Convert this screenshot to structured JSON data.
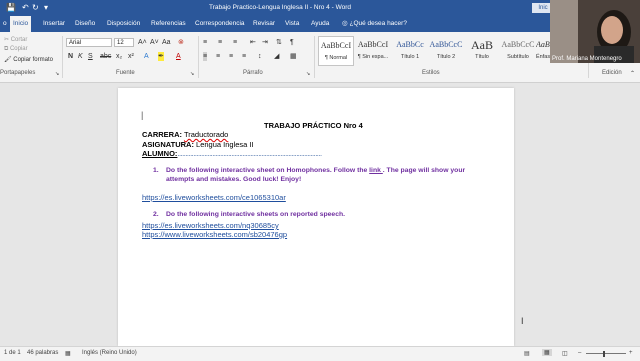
{
  "window": {
    "title": "Trabajo Practico-Lengua Inglesa II - Nro 4 - Word",
    "signin": "Inic"
  },
  "tabs": [
    "Inicio",
    "Insertar",
    "Diseño",
    "Disposición",
    "Referencias",
    "Correspondencia",
    "Revisar",
    "Vista",
    "Ayuda"
  ],
  "tab_file": "o",
  "tell_me": "¿Qué desea hacer?",
  "ribbon": {
    "clipboard": {
      "cut": "Cortar",
      "copy": "Copiar",
      "format_painter": "Copiar formato",
      "label": "Portapapeles"
    },
    "font": {
      "name": "Arial",
      "size": "12",
      "label": "Fuente"
    },
    "paragraph": {
      "label": "Párrafo"
    },
    "styles": {
      "label": "Estilos",
      "items": [
        {
          "sample": "AaBbCcI",
          "name": "¶ Normal"
        },
        {
          "sample": "AaBbCcI",
          "name": "¶ Sin espa..."
        },
        {
          "sample": "AaBbCc",
          "name": "Título 1"
        },
        {
          "sample": "AaBbCcC",
          "name": "Título 2"
        },
        {
          "sample": "AaB",
          "name": "Título"
        },
        {
          "sample": "AaBbCcC",
          "name": "Subtítulo"
        },
        {
          "sample": "AaBbCcI",
          "name": "Énfasis"
        }
      ]
    },
    "editing": {
      "label": "Edición",
      "select": "Seleccionar"
    }
  },
  "webcam": {
    "name": "Prof. Mariana Montenegro"
  },
  "document": {
    "title": "TRABAJO PRÁCTICO Nro 4",
    "carrera_label": "CARRERA:",
    "carrera_value": "Traductorado",
    "asignatura_label": "ASIGNATURA:",
    "asignatura_value": "Lengua Inglesa II",
    "alumno_label": "ALUMNO:",
    "alumno_line": "...........................................................................................",
    "item1_num": "1.",
    "item1_line1_a": "Do the following interactive sheet on Homophones. Follow the ",
    "item1_link": "link ",
    "item1_line1_b": ". The page will show your",
    "item1_line2": "attempts and mistakes. Good luck! Enjoy!",
    "link1": "https://es.liveworksheets.com/ce1065310ar",
    "item2_num": "2.",
    "item2_text": "Do the following interactive sheets on reported speech.",
    "link2": "https://es.liveworksheets.com/nq30685cy",
    "link3": "https://www.liveworksheets.com/sb20476gp"
  },
  "status": {
    "page": "1 de 1",
    "words": "46 palabras",
    "language": "Inglés (Reino Unido)"
  }
}
